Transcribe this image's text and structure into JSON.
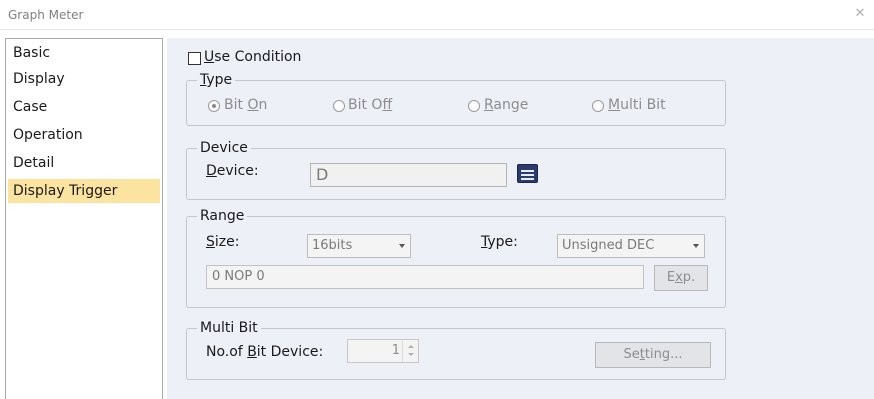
{
  "window": {
    "title": "Graph Meter"
  },
  "sidebar": {
    "items": [
      {
        "label": "Basic"
      },
      {
        "label": "Display"
      },
      {
        "label": "Case"
      },
      {
        "label": "Operation"
      },
      {
        "label": "Detail"
      },
      {
        "label": "Display Trigger",
        "selected": true
      }
    ]
  },
  "use_condition": {
    "mn": "U",
    "rest": "se Condition",
    "checked": false
  },
  "type_group": {
    "title_mn": "T",
    "title_rest": "ype",
    "bit_on": {
      "pre": "Bit ",
      "mn": "O",
      "post": "n",
      "selected": true
    },
    "bit_off": {
      "pre": "Bit O",
      "mn": "f",
      "post": "f",
      "selected": false
    },
    "range": {
      "pre": "",
      "mn": "R",
      "post": "ange",
      "selected": false
    },
    "multi_bit": {
      "pre": "",
      "mn": "M",
      "post": "ulti Bit",
      "selected": false
    }
  },
  "device_group": {
    "title": "Device",
    "label_mn": "D",
    "label_rest": "evice:",
    "value": "D",
    "browse_icon": "device-browse-icon"
  },
  "range_group": {
    "title": "Range",
    "size_label_mn": "S",
    "size_label_rest": "ize:",
    "size_value": "16bits",
    "type_label_mn": "T",
    "type_label_rest": "ype:",
    "type_value": "Unsigned DEC",
    "expression": "0 NOP 0",
    "exp_pre": "E",
    "exp_mn": "x",
    "exp_post": "p."
  },
  "multibit_group": {
    "title": "Multi Bit",
    "label_pre": "No.of ",
    "label_mn": "B",
    "label_post": "it Device:",
    "value": "1",
    "setting_pre": "Se",
    "setting_mn": "t",
    "setting_post": "ting..."
  },
  "colors": {
    "panel_bg": "#eef0f7",
    "selected_item": "#fde3a0",
    "group_border": "#c4c7cf",
    "disabled_text": "#8d8d8d",
    "device_button": "#2a3c6d"
  }
}
